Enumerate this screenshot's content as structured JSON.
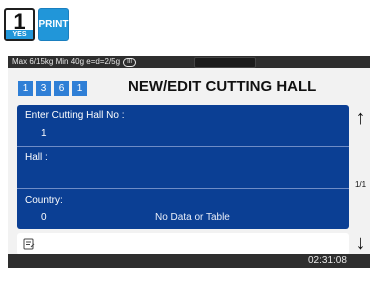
{
  "top_buttons": {
    "yes": {
      "number": "1",
      "label": "YES"
    },
    "print": {
      "label": "PRINT"
    }
  },
  "status_bar": {
    "text": "Max 6/15kg Min 40g e=d=2/5g",
    "badge": "III"
  },
  "header": {
    "codes": [
      "1",
      "3",
      "6",
      "1"
    ],
    "title": "NEW/EDIT CUTTING HALL"
  },
  "form": {
    "fields": [
      {
        "label": "Enter Cutting Hall No :",
        "value": "1"
      },
      {
        "label": "Hall :",
        "value": ""
      },
      {
        "label": "Country:",
        "value": "0",
        "hint": "No Data or Table"
      }
    ]
  },
  "pagination": {
    "indicator": "1/1"
  },
  "footer": {
    "time": "02:31:08"
  },
  "icons": [
    "arrow-up-icon",
    "arrow-down-icon",
    "note-edit-icon"
  ],
  "colors": {
    "accent_blue": "#2196d9",
    "form_bg": "#0b3f94",
    "code_box": "#2f7fd6",
    "status_bar": "#2e2e2e"
  }
}
